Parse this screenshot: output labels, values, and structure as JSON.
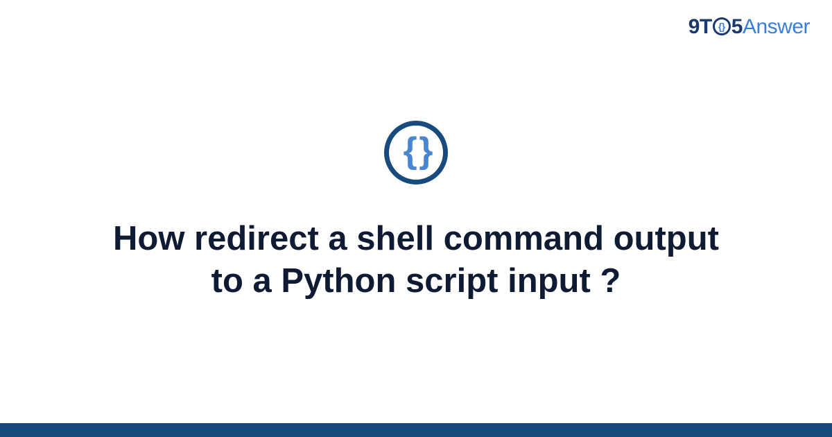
{
  "logo": {
    "part1": "9T",
    "circle_inner": "{}",
    "part2": "5",
    "part3": "Answer"
  },
  "icon": {
    "glyph": "{ }"
  },
  "title": "How redirect a shell command output to a Python script input ?",
  "colors": {
    "dark_navy": "#184a7e",
    "text_dark": "#0f1b33",
    "blue_light": "#4a86d0",
    "link_blue": "#3b7dd8"
  }
}
